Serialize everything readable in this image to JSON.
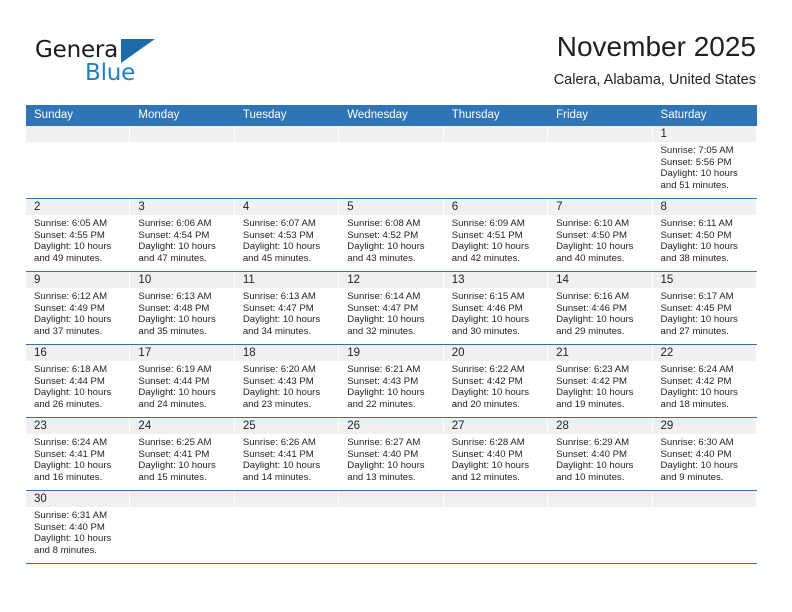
{
  "brand": {
    "name_part1": "General",
    "name_part2": "Blue",
    "logo_icon": "triangle-flag-icon",
    "color_black": "#1a1a1a",
    "color_blue": "#1f7fc4"
  },
  "header": {
    "title": "November 2025",
    "subtitle": "Calera, Alabama, United States"
  },
  "theme": {
    "header_bg": "#2f75b5",
    "header_text": "#ffffff",
    "daynum_band_bg": "#f0f0f0",
    "row_separator": "#2f75b5",
    "body_text": "#231f20"
  },
  "calendar": {
    "weekday_headers": [
      "Sunday",
      "Monday",
      "Tuesday",
      "Wednesday",
      "Thursday",
      "Friday",
      "Saturday"
    ],
    "weeks": [
      [
        {
          "empty": true
        },
        {
          "empty": true
        },
        {
          "empty": true
        },
        {
          "empty": true
        },
        {
          "empty": true
        },
        {
          "empty": true
        },
        {
          "day": "1",
          "sunrise": "Sunrise: 7:05 AM",
          "sunset": "Sunset: 5:56 PM",
          "daylight1": "Daylight: 10 hours",
          "daylight2": "and 51 minutes."
        }
      ],
      [
        {
          "day": "2",
          "sunrise": "Sunrise: 6:05 AM",
          "sunset": "Sunset: 4:55 PM",
          "daylight1": "Daylight: 10 hours",
          "daylight2": "and 49 minutes."
        },
        {
          "day": "3",
          "sunrise": "Sunrise: 6:06 AM",
          "sunset": "Sunset: 4:54 PM",
          "daylight1": "Daylight: 10 hours",
          "daylight2": "and 47 minutes."
        },
        {
          "day": "4",
          "sunrise": "Sunrise: 6:07 AM",
          "sunset": "Sunset: 4:53 PM",
          "daylight1": "Daylight: 10 hours",
          "daylight2": "and 45 minutes."
        },
        {
          "day": "5",
          "sunrise": "Sunrise: 6:08 AM",
          "sunset": "Sunset: 4:52 PM",
          "daylight1": "Daylight: 10 hours",
          "daylight2": "and 43 minutes."
        },
        {
          "day": "6",
          "sunrise": "Sunrise: 6:09 AM",
          "sunset": "Sunset: 4:51 PM",
          "daylight1": "Daylight: 10 hours",
          "daylight2": "and 42 minutes."
        },
        {
          "day": "7",
          "sunrise": "Sunrise: 6:10 AM",
          "sunset": "Sunset: 4:50 PM",
          "daylight1": "Daylight: 10 hours",
          "daylight2": "and 40 minutes."
        },
        {
          "day": "8",
          "sunrise": "Sunrise: 6:11 AM",
          "sunset": "Sunset: 4:50 PM",
          "daylight1": "Daylight: 10 hours",
          "daylight2": "and 38 minutes."
        }
      ],
      [
        {
          "day": "9",
          "sunrise": "Sunrise: 6:12 AM",
          "sunset": "Sunset: 4:49 PM",
          "daylight1": "Daylight: 10 hours",
          "daylight2": "and 37 minutes."
        },
        {
          "day": "10",
          "sunrise": "Sunrise: 6:13 AM",
          "sunset": "Sunset: 4:48 PM",
          "daylight1": "Daylight: 10 hours",
          "daylight2": "and 35 minutes."
        },
        {
          "day": "11",
          "sunrise": "Sunrise: 6:13 AM",
          "sunset": "Sunset: 4:47 PM",
          "daylight1": "Daylight: 10 hours",
          "daylight2": "and 34 minutes."
        },
        {
          "day": "12",
          "sunrise": "Sunrise: 6:14 AM",
          "sunset": "Sunset: 4:47 PM",
          "daylight1": "Daylight: 10 hours",
          "daylight2": "and 32 minutes."
        },
        {
          "day": "13",
          "sunrise": "Sunrise: 6:15 AM",
          "sunset": "Sunset: 4:46 PM",
          "daylight1": "Daylight: 10 hours",
          "daylight2": "and 30 minutes."
        },
        {
          "day": "14",
          "sunrise": "Sunrise: 6:16 AM",
          "sunset": "Sunset: 4:46 PM",
          "daylight1": "Daylight: 10 hours",
          "daylight2": "and 29 minutes."
        },
        {
          "day": "15",
          "sunrise": "Sunrise: 6:17 AM",
          "sunset": "Sunset: 4:45 PM",
          "daylight1": "Daylight: 10 hours",
          "daylight2": "and 27 minutes."
        }
      ],
      [
        {
          "day": "16",
          "sunrise": "Sunrise: 6:18 AM",
          "sunset": "Sunset: 4:44 PM",
          "daylight1": "Daylight: 10 hours",
          "daylight2": "and 26 minutes."
        },
        {
          "day": "17",
          "sunrise": "Sunrise: 6:19 AM",
          "sunset": "Sunset: 4:44 PM",
          "daylight1": "Daylight: 10 hours",
          "daylight2": "and 24 minutes."
        },
        {
          "day": "18",
          "sunrise": "Sunrise: 6:20 AM",
          "sunset": "Sunset: 4:43 PM",
          "daylight1": "Daylight: 10 hours",
          "daylight2": "and 23 minutes."
        },
        {
          "day": "19",
          "sunrise": "Sunrise: 6:21 AM",
          "sunset": "Sunset: 4:43 PM",
          "daylight1": "Daylight: 10 hours",
          "daylight2": "and 22 minutes."
        },
        {
          "day": "20",
          "sunrise": "Sunrise: 6:22 AM",
          "sunset": "Sunset: 4:42 PM",
          "daylight1": "Daylight: 10 hours",
          "daylight2": "and 20 minutes."
        },
        {
          "day": "21",
          "sunrise": "Sunrise: 6:23 AM",
          "sunset": "Sunset: 4:42 PM",
          "daylight1": "Daylight: 10 hours",
          "daylight2": "and 19 minutes."
        },
        {
          "day": "22",
          "sunrise": "Sunrise: 6:24 AM",
          "sunset": "Sunset: 4:42 PM",
          "daylight1": "Daylight: 10 hours",
          "daylight2": "and 18 minutes."
        }
      ],
      [
        {
          "day": "23",
          "sunrise": "Sunrise: 6:24 AM",
          "sunset": "Sunset: 4:41 PM",
          "daylight1": "Daylight: 10 hours",
          "daylight2": "and 16 minutes."
        },
        {
          "day": "24",
          "sunrise": "Sunrise: 6:25 AM",
          "sunset": "Sunset: 4:41 PM",
          "daylight1": "Daylight: 10 hours",
          "daylight2": "and 15 minutes."
        },
        {
          "day": "25",
          "sunrise": "Sunrise: 6:26 AM",
          "sunset": "Sunset: 4:41 PM",
          "daylight1": "Daylight: 10 hours",
          "daylight2": "and 14 minutes."
        },
        {
          "day": "26",
          "sunrise": "Sunrise: 6:27 AM",
          "sunset": "Sunset: 4:40 PM",
          "daylight1": "Daylight: 10 hours",
          "daylight2": "and 13 minutes."
        },
        {
          "day": "27",
          "sunrise": "Sunrise: 6:28 AM",
          "sunset": "Sunset: 4:40 PM",
          "daylight1": "Daylight: 10 hours",
          "daylight2": "and 12 minutes."
        },
        {
          "day": "28",
          "sunrise": "Sunrise: 6:29 AM",
          "sunset": "Sunset: 4:40 PM",
          "daylight1": "Daylight: 10 hours",
          "daylight2": "and 10 minutes."
        },
        {
          "day": "29",
          "sunrise": "Sunrise: 6:30 AM",
          "sunset": "Sunset: 4:40 PM",
          "daylight1": "Daylight: 10 hours",
          "daylight2": "and 9 minutes."
        }
      ],
      [
        {
          "day": "30",
          "sunrise": "Sunrise: 6:31 AM",
          "sunset": "Sunset: 4:40 PM",
          "daylight1": "Daylight: 10 hours",
          "daylight2": "and 8 minutes."
        },
        {
          "empty": true
        },
        {
          "empty": true
        },
        {
          "empty": true
        },
        {
          "empty": true
        },
        {
          "empty": true
        },
        {
          "empty": true
        }
      ]
    ]
  }
}
